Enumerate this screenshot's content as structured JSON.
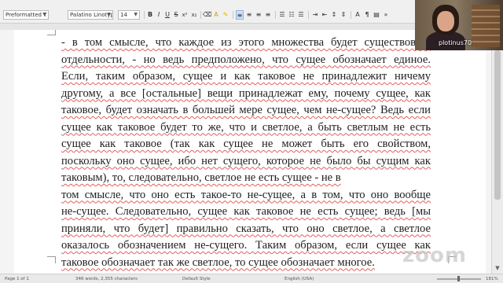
{
  "toolbar": {
    "paragraph_style": "Preformatted T",
    "font_name": "Palatino Linotyp",
    "font_size": "14",
    "buttons": [
      {
        "label": "B",
        "name": "bold-button"
      },
      {
        "label": "I",
        "name": "italic-button"
      },
      {
        "label": "U",
        "name": "underline-button"
      },
      {
        "label": "S",
        "name": "strikethrough-button"
      },
      {
        "label": "x²",
        "name": "superscript-button"
      },
      {
        "label": "x₂",
        "name": "subscript-button"
      }
    ]
  },
  "document": {
    "lines": [
      "- в том смысле, что каждое из этого множества будет существовать",
      "отдельности, - но ведь предположено, что сущее обозначает единое.",
      "Если, таким образом, сущее и как таковое не принадлежит ничему",
      "другому, а все [остальные] вещи принадлежат ему, почему сущее, как",
      "таковое, будет означать в большей мере сущее, чем не-сущее? Ведь если",
      "сущее как таковое будет то же, что и светлое, а быть светлым не есть",
      "сущее как таковое (так как сущее не может быть его свойством,",
      "поскольку оно сущее, ибо нет сущего, которое не было бы сущим как",
      "таковым), то, следовательно, светлое не есть сущее - не в",
      "том смысле, что оно есть такое-то не-сущее, а в том, что оно вообще",
      "не-сущее. Следовательно, сущее как таковое не есть сущее; ведь [мы",
      "приняли, что будет] правильно сказать, что оно светлое, а светлое",
      "оказалось обозначением не-сущего. Таким образом, если сущее как",
      "таковое обозначает так же светлое, то сущее обозначает многое."
    ]
  },
  "video": {
    "participant_name": "plotinus70"
  },
  "watermark": "zoom",
  "statusbar": {
    "page": "Page 1 of 1",
    "words": "346 words, 2,355 characters",
    "page_style": "Default Style",
    "language": "English (USA)",
    "zoom": "181%"
  }
}
